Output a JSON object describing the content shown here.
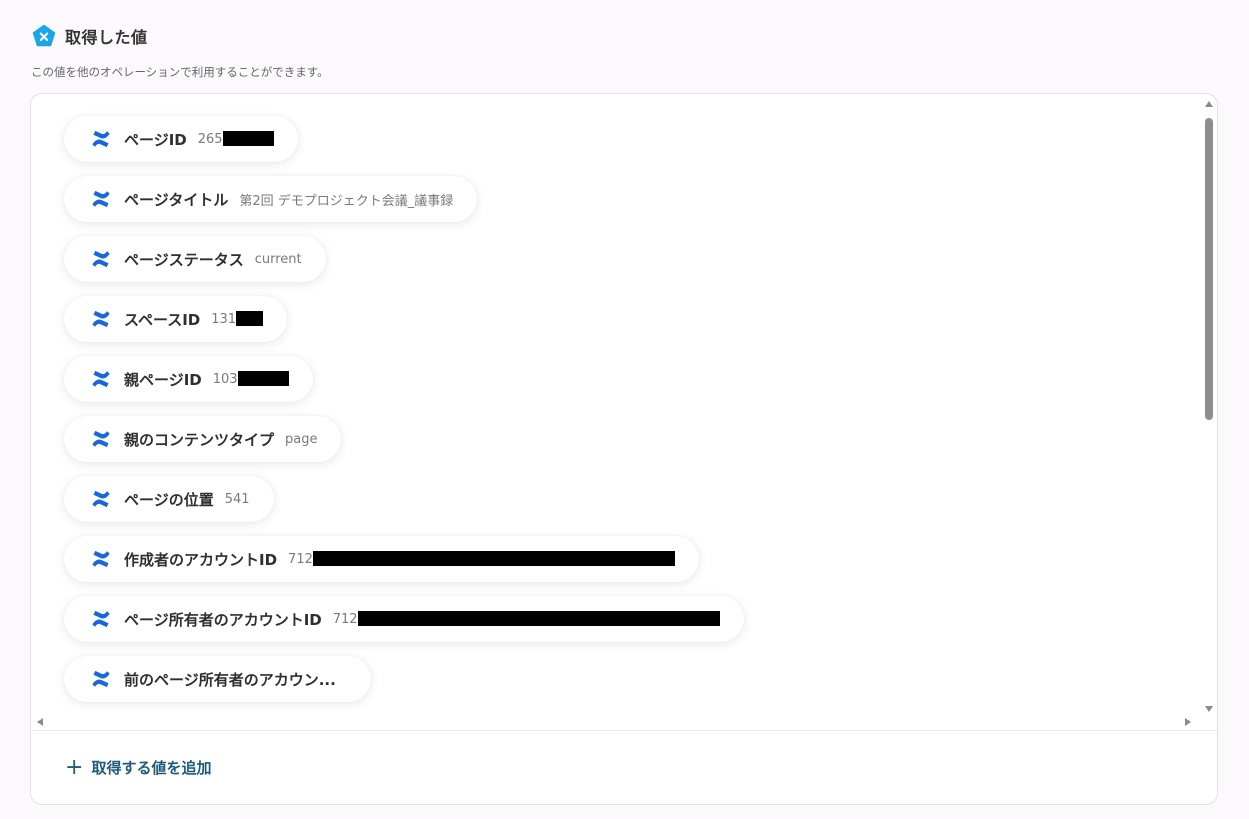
{
  "header": {
    "title": "取得した値",
    "subtitle": "この値を他のオペレーションで利用することができます。"
  },
  "items": [
    {
      "label": "ページID",
      "value": "265",
      "redacted": true
    },
    {
      "label": "ページタイトル",
      "value": "第2回 デモプロジェクト会議_議事録",
      "redacted": false
    },
    {
      "label": "ページステータス",
      "value": "current",
      "redacted": false
    },
    {
      "label": "スペースID",
      "value": "131",
      "redacted": true
    },
    {
      "label": "親ページID",
      "value": "103",
      "redacted": true
    },
    {
      "label": "親のコンテンツタイプ",
      "value": "page",
      "redacted": false
    },
    {
      "label": "ページの位置",
      "value": "541",
      "redacted": false
    },
    {
      "label": "作成者のアカウントID",
      "value": "712",
      "redacted": true
    },
    {
      "label": "ページ所有者のアカウントID",
      "value": "712",
      "redacted": true
    },
    {
      "label": "前のページ所有者のアカウン...",
      "value": "",
      "redacted": false
    }
  ],
  "footer": {
    "add_label": "取得する値を追加"
  },
  "icons": {
    "header_icon": "yoom-pentagon-x-icon",
    "item_icon": "confluence-icon",
    "add_icon": "plus-icon"
  },
  "colors": {
    "accent": "#1d5b78",
    "header_icon": "#1aa6e8",
    "confluence_blue": "#1868db"
  }
}
